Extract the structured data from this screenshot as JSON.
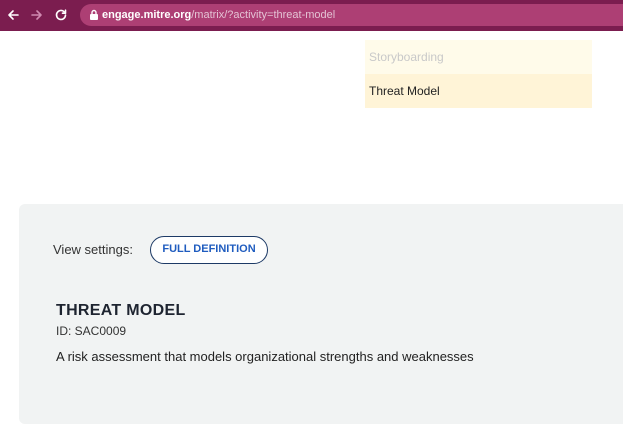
{
  "browser": {
    "url_host": "engage.mitre.org",
    "url_path": "/matrix/?activity=threat-model"
  },
  "dropdown": {
    "items": [
      "Storyboarding",
      "Threat Model"
    ],
    "selected": "Threat Model"
  },
  "definition": {
    "view_settings_label": "View settings:",
    "view_mode_button": "FULL DEFINITION",
    "title": "THREAT MODEL",
    "id_line": "ID: SAC0009",
    "description": "A risk assessment that models organizational strengths and weaknesses"
  },
  "colors": {
    "browser_bar": "#7b1d4f",
    "urlbar": "#ad3f74",
    "dropdown_bg": "#fffbea",
    "panel_bg": "#f1f3f3",
    "pill_border": "#1d3a66",
    "pill_text": "#1f5cbf"
  }
}
